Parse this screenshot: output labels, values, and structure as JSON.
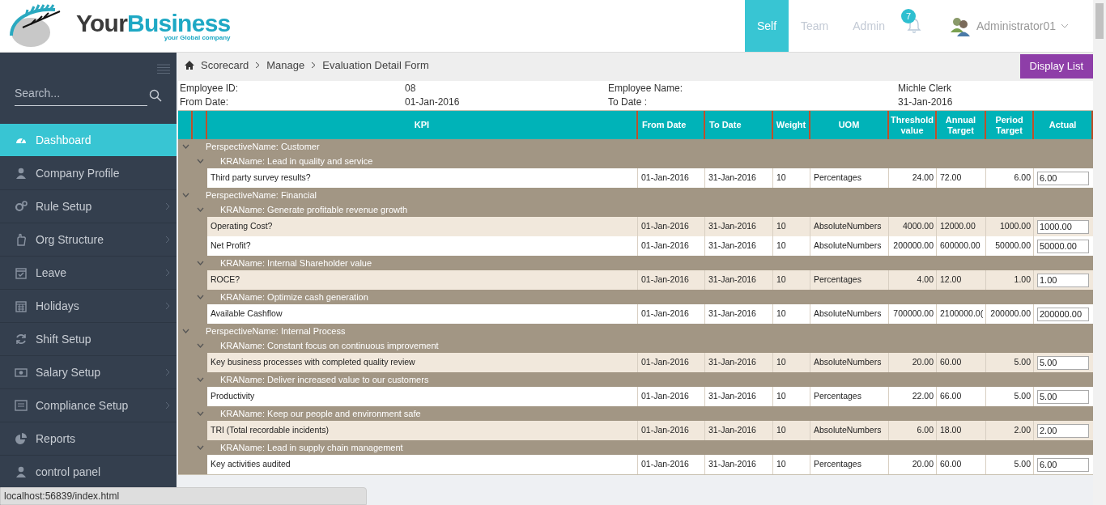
{
  "header": {
    "logo_word_1": "Your",
    "logo_word_2": "Business",
    "logo_tagline": "your Global company",
    "tabs": [
      {
        "label": "Self",
        "selected": true
      },
      {
        "label": "Team",
        "selected": false
      },
      {
        "label": "Admin",
        "selected": false
      }
    ],
    "notification_count": "7",
    "user": "Administrator01"
  },
  "sidebar": {
    "search": {
      "placeholder": "Search..."
    },
    "items": [
      {
        "label": "Dashboard",
        "selected": true,
        "expandable": false
      },
      {
        "label": "Company Profile",
        "selected": false,
        "expandable": false
      },
      {
        "label": "Rule Setup",
        "selected": false,
        "expandable": true
      },
      {
        "label": "Org Structure",
        "selected": false,
        "expandable": true
      },
      {
        "label": "Leave",
        "selected": false,
        "expandable": true
      },
      {
        "label": "Holidays",
        "selected": false,
        "expandable": true
      },
      {
        "label": "Shift Setup",
        "selected": false,
        "expandable": false
      },
      {
        "label": "Salary Setup",
        "selected": false,
        "expandable": true
      },
      {
        "label": "Compliance Setup",
        "selected": false,
        "expandable": true
      },
      {
        "label": "Reports",
        "selected": false,
        "expandable": false
      },
      {
        "label": "control panel",
        "selected": false,
        "expandable": false
      }
    ]
  },
  "breadcrumb": [
    "Scorecard",
    "Manage",
    "Evaluation Detail Form"
  ],
  "display_list_button": "Display List",
  "info": [
    {
      "label": "Employee ID:",
      "value": "08",
      "label2": "Employee Name:",
      "value2": "Michle Clerk"
    },
    {
      "label": "From Date:",
      "value": "01-Jan-2016",
      "label2": "To Date :",
      "value2": "31-Jan-2016"
    }
  ],
  "table": {
    "columns": [
      "KPI",
      "From Date",
      "To Date",
      "Weight",
      "UOM",
      "Threshold value",
      "Annual Target",
      "Period Target",
      "Actual"
    ],
    "perspectives": [
      {
        "name": "PerspectiveName: Customer",
        "expanded": true,
        "kras": [
          {
            "name": "KRAName: Lead in quality and service",
            "expanded": true,
            "rows": [
              [
                "Third party survey results?",
                "01-Jan-2016",
                "31-Jan-2016",
                "10",
                "Percentages",
                "24.00",
                "72.00",
                "6.00",
                "6.00"
              ]
            ]
          }
        ]
      },
      {
        "name": "PerspectiveName: Financial",
        "expanded": true,
        "kras": [
          {
            "name": "KRAName: Generate profitable revenue growth",
            "expanded": true,
            "rows": [
              [
                "Operating Cost?",
                "01-Jan-2016",
                "31-Jan-2016",
                "10",
                "AbsoluteNumbers",
                "4000.00",
                "12000.00",
                "1000.00",
                "1000.00"
              ],
              [
                "Net Profit?",
                "01-Jan-2016",
                "31-Jan-2016",
                "10",
                "AbsoluteNumbers",
                "200000.00",
                "600000.00",
                "50000.00",
                "50000.00"
              ]
            ]
          },
          {
            "name": "KRAName: Internal Shareholder value",
            "expanded": true,
            "rows": [
              [
                "ROCE?",
                "01-Jan-2016",
                "31-Jan-2016",
                "10",
                "Percentages",
                "4.00",
                "12.00",
                "1.00",
                "1.00"
              ]
            ]
          },
          {
            "name": "KRAName: Optimize cash generation",
            "expanded": true,
            "rows": [
              [
                "Available Cashflow",
                "01-Jan-2016",
                "31-Jan-2016",
                "10",
                "AbsoluteNumbers",
                "700000.00",
                "2100000.0(",
                "200000.00",
                "200000.00"
              ]
            ]
          }
        ]
      },
      {
        "name": "PerspectiveName: Internal Process",
        "expanded": true,
        "kras": [
          {
            "name": "KRAName: Constant focus on continuous improvement",
            "expanded": true,
            "rows": [
              [
                "Key business processes with completed quality review",
                "01-Jan-2016",
                "31-Jan-2016",
                "10",
                "AbsoluteNumbers",
                "20.00",
                "60.00",
                "5.00",
                "5.00"
              ]
            ]
          },
          {
            "name": "KRAName: Deliver increased value to our customers",
            "expanded": true,
            "rows": [
              [
                "Productivity",
                "01-Jan-2016",
                "31-Jan-2016",
                "10",
                "Percentages",
                "22.00",
                "66.00",
                "5.00",
                "5.00"
              ]
            ]
          },
          {
            "name": "KRAName: Keep our people and environment safe",
            "expanded": true,
            "rows": [
              [
                "TRI (Total recordable incidents)",
                "01-Jan-2016",
                "31-Jan-2016",
                "10",
                "AbsoluteNumbers",
                "6.00",
                "18.00",
                "2.00",
                "2.00"
              ]
            ]
          },
          {
            "name": "KRAName: Lead in supply chain management",
            "expanded": true,
            "rows": [
              [
                "Key activities audited",
                "01-Jan-2016",
                "31-Jan-2016",
                "10",
                "Percentages",
                "20.00",
                "60.00",
                "5.00",
                "6.00"
              ]
            ]
          }
        ]
      }
    ]
  },
  "status_bar": "localhost:56839/index.html"
}
